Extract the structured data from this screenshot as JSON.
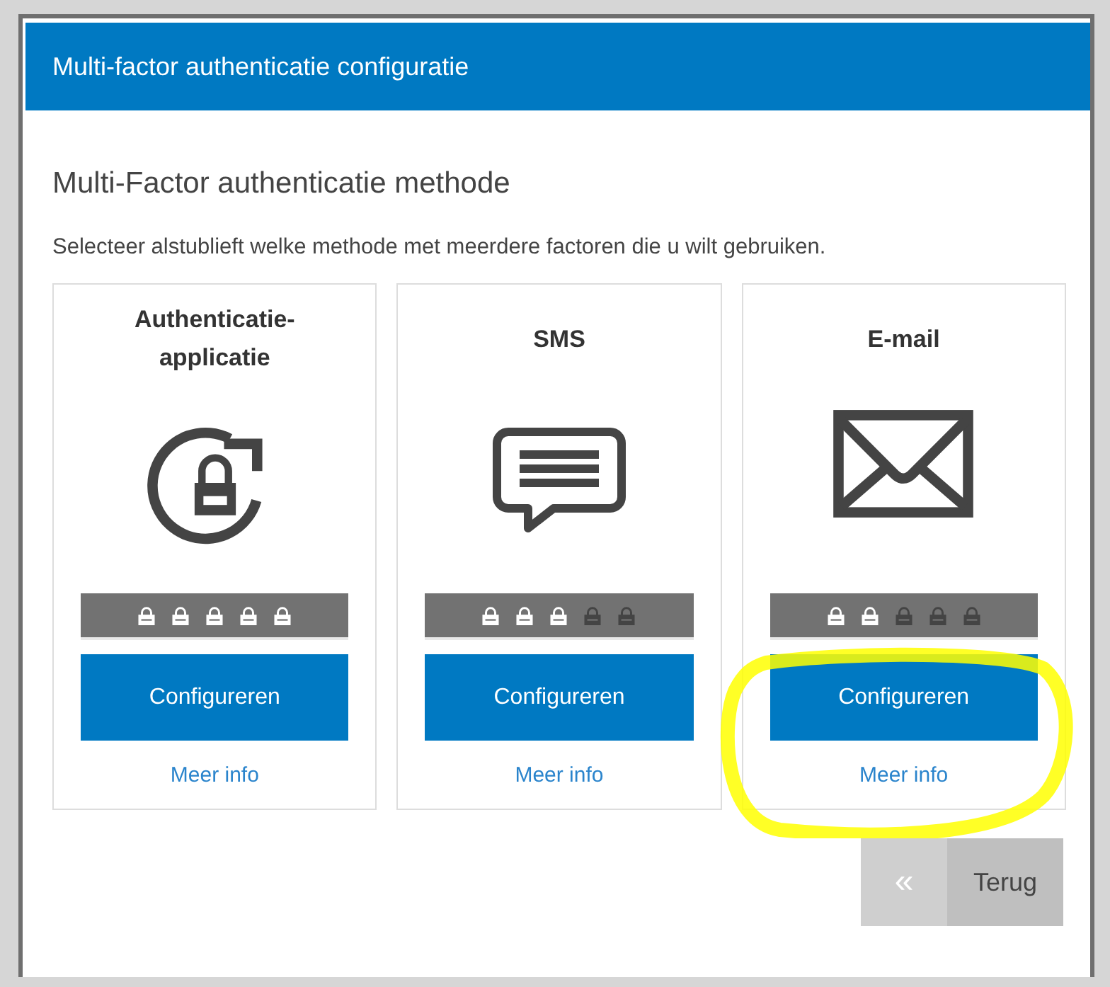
{
  "dialog": {
    "title": "Multi-factor authenticatie configuratie",
    "heading": "Multi-Factor authenticatie methode",
    "description": "Selecteer alstublieft welke methode met meerdere factoren die u wilt gebruiken.",
    "methods": [
      {
        "kind": "app",
        "title": "Authenticatie-\napplicatie",
        "stars": 5,
        "button": "Configureren",
        "link": "Meer info",
        "highlighted": false
      },
      {
        "kind": "sms",
        "title": "SMS",
        "stars": 3,
        "button": "Configureren",
        "link": "Meer info",
        "highlighted": false
      },
      {
        "kind": "email",
        "title": "E-mail",
        "stars": 2,
        "button": "Configureren",
        "link": "Meer info",
        "highlighted": true
      }
    ],
    "back_button": {
      "icon": "«",
      "label": "Terug"
    }
  }
}
